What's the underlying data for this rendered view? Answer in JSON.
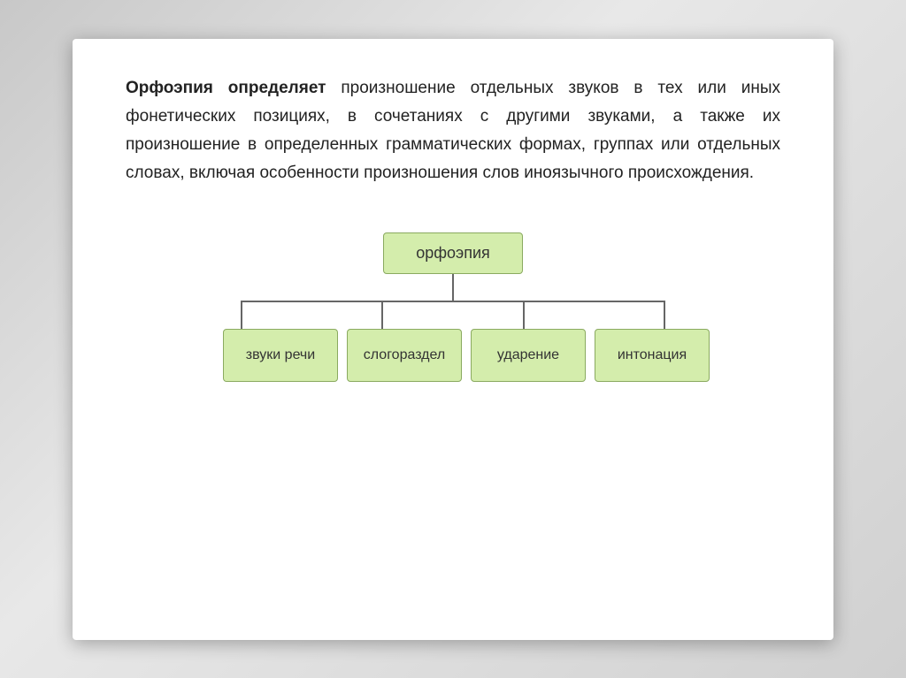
{
  "slide": {
    "paragraph": {
      "bold_part": "Орфоэпия определяет",
      "normal_part": " произношение отдельных звуков в тех или иных фонетических позициях, в сочетаниях с другими звуками, а также их произношение в определенных грамматических формах, группах или отдельных словах, включая особенности произношения слов иноязычного происхождения."
    },
    "diagram": {
      "root": "орфоэпия",
      "children": [
        "звуки речи",
        "слогораздел",
        "ударение",
        "интонация"
      ]
    }
  }
}
